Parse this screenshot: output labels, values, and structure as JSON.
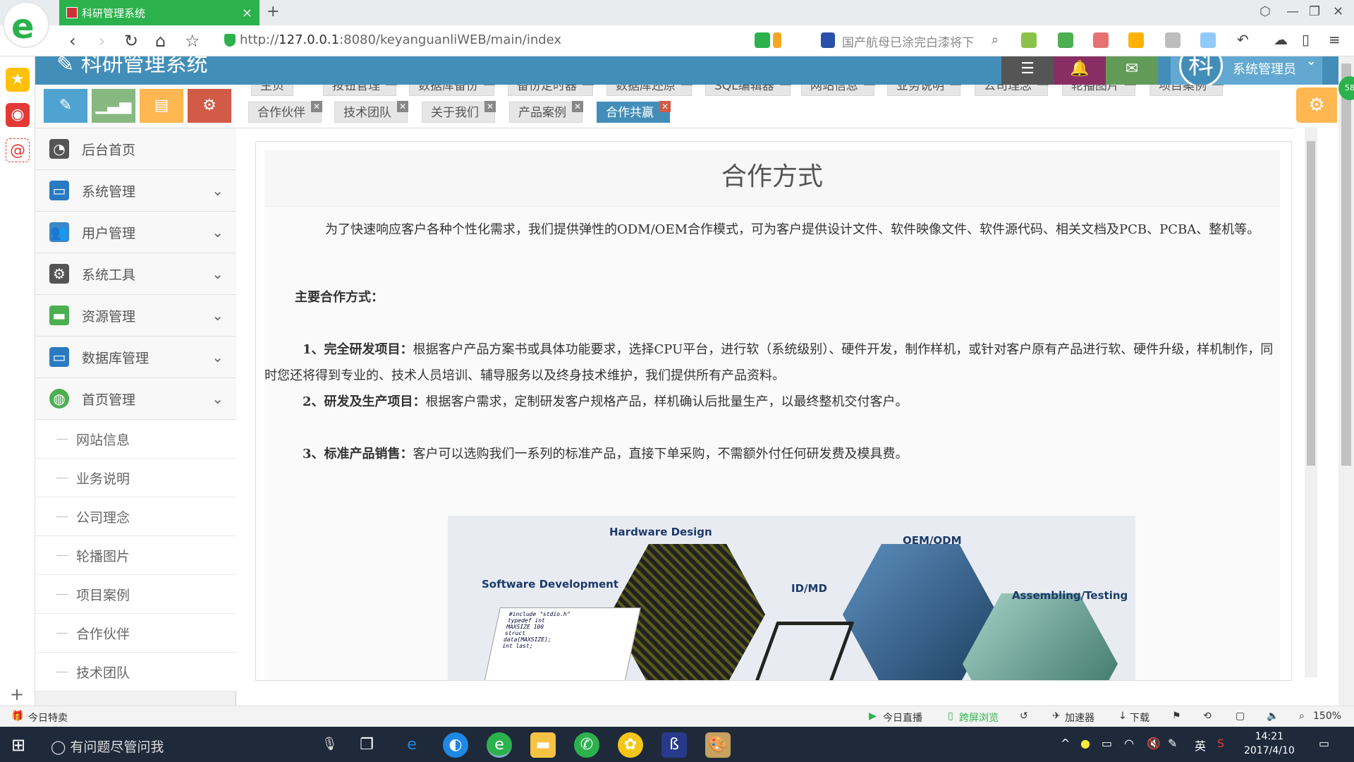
{
  "browser": {
    "tab_title": "科研管理系统",
    "url_scheme": "http://",
    "url_host": "127.0.0.1",
    "url_rest": ":8080/keyanguanliWEB/main/index",
    "search_text": "国产航母已涂完白漆将下"
  },
  "app": {
    "title": "科研管理系统",
    "user_name": "系统管理员",
    "avatar_char": "科",
    "badge_count": "58"
  },
  "sidebar": {
    "menu": [
      {
        "label": "后台首页"
      },
      {
        "label": "系统管理"
      },
      {
        "label": "用户管理"
      },
      {
        "label": "系统工具"
      },
      {
        "label": "资源管理"
      },
      {
        "label": "数据库管理"
      },
      {
        "label": "首页管理"
      }
    ],
    "submenu": [
      {
        "label": "网站信息"
      },
      {
        "label": "业务说明"
      },
      {
        "label": "公司理念"
      },
      {
        "label": "轮播图片"
      },
      {
        "label": "项目案例"
      },
      {
        "label": "合作伙伴"
      },
      {
        "label": "技术团队"
      }
    ]
  },
  "tabs_row1": [
    {
      "label": "主页"
    },
    {
      "label": "按钮管理"
    },
    {
      "label": "数据库备份"
    },
    {
      "label": "备份定时器"
    },
    {
      "label": "数据库还原"
    },
    {
      "label": "SQL编辑器"
    },
    {
      "label": "网站信息"
    },
    {
      "label": "业务说明"
    },
    {
      "label": "公司理念"
    },
    {
      "label": "轮播图片"
    },
    {
      "label": "项目案例"
    }
  ],
  "tabs_row2": [
    {
      "label": "合作伙伴"
    },
    {
      "label": "技术团队"
    },
    {
      "label": "关于我们"
    },
    {
      "label": "产品案例"
    },
    {
      "label": "合作共赢"
    }
  ],
  "content": {
    "heading": "合作方式",
    "intro": "为了快速响应客户各种个性化需求，我们提供弹性的ODM/OEM合作模式，可为客户提供设计文件、软件映像文件、软件源代码、相关文档及PCB、PCBA、整机等。",
    "section_title": "主要合作方式：",
    "item1_title": "1、完全研发项目：",
    "item1_text": "根据客户产品方案书或具体功能要求，选择CPU平台，进行软（系统级别）、硬件开发，制作样机，或针对客户原有产品进行软、硬件升级，样机制作，同时您还将得到专业的、技术人员培训、辅导服务以及终身技术维护，我们提供所有产品资料。",
    "item2_title": "2、研发及生产项目：",
    "item2_text": "根据客户需求，定制研发客户规格产品，样机确认后批量生产，以最终整机交付客户。",
    "item3_title": "3、标准产品销售：",
    "item3_text": "客户可以选购我们一系列的标准产品，直接下单采购，不需额外付任何研发费及模具费。",
    "illustration_labels": {
      "hardware": "Hardware Design",
      "software": "Software Development",
      "idmd": "ID/MD",
      "oem": "OEM/ODM",
      "assembling": "Assembling/Testing"
    }
  },
  "statusbar": {
    "left": "今日特卖",
    "live": "今日直播",
    "crossscreen": "跨屏浏览",
    "accelerator": "加速器",
    "download": "下载",
    "zoom": "150%"
  },
  "taskbar": {
    "search_placeholder": "有问题尽管问我",
    "ime": "英",
    "time": "14:21",
    "date": "2017/4/10"
  },
  "colors": {
    "header_blue": "#438eb9",
    "active_tab": "#438eb9",
    "browser_green": "#2bb24c",
    "shortcut_blue": "#4fa3d1",
    "shortcut_green": "#87b87f",
    "shortcut_orange": "#ffb752",
    "shortcut_red": "#d15b47"
  }
}
